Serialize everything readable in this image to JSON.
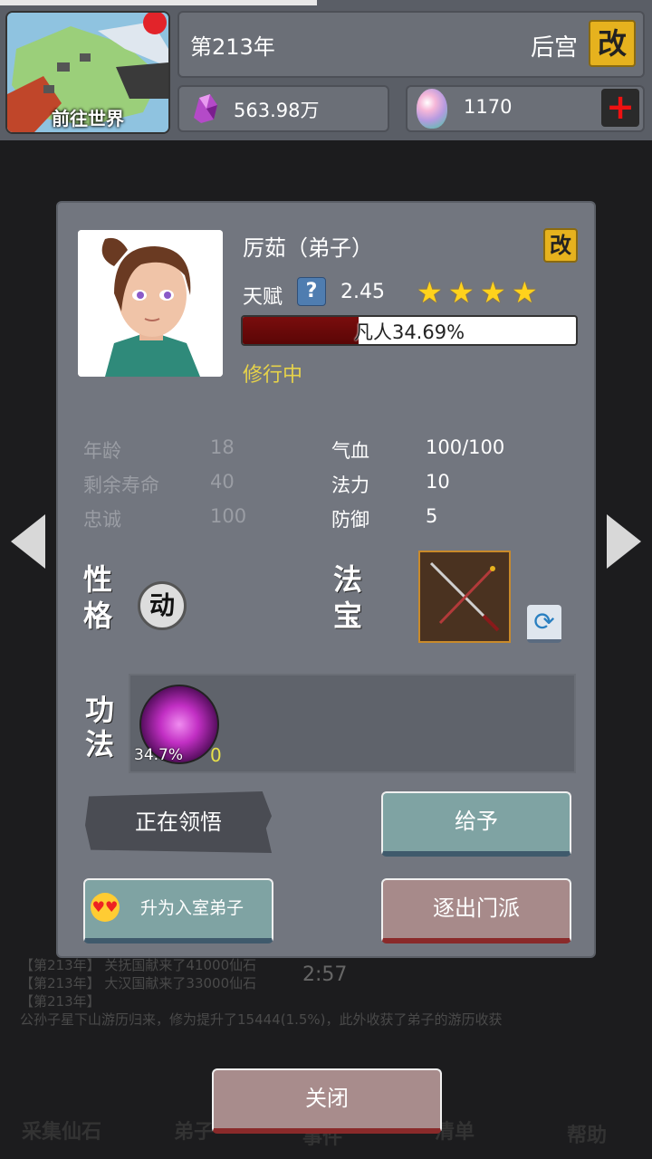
{
  "header": {
    "world_button_label": "前往世界",
    "year": "第213年",
    "harem_label": "后宫",
    "harem_edit": "改",
    "spirit_stones": "563.98万",
    "eggs": "1170",
    "plus_icon": "plus-icon"
  },
  "background": {
    "timer": "2:57",
    "log_lines": [
      "【第213年】 关抚国献来了41000仙石",
      "【第213年】 大汉国献来了33000仙石",
      "【第213年】",
      "公孙子星下山游历归来，修为提升了15444(1.5%)，此外收获了弟子的游历收获"
    ],
    "bottom_nav": [
      "采集仙石",
      "弟子",
      "事件",
      "清单",
      "帮助"
    ]
  },
  "dialog": {
    "name": "厉茹（弟子）",
    "name_edit": "改",
    "talent_label": "天赋",
    "talent_help": "?",
    "talent_value": "2.45",
    "stars": 4,
    "cultivation_text": "凡人34.69%",
    "cultivation_progress": 0.3469,
    "status": "修行中",
    "stats_left": [
      {
        "label": "年龄",
        "value": "18"
      },
      {
        "label": "剩余寿命",
        "value": "40"
      },
      {
        "label": "忠诚",
        "value": "100"
      }
    ],
    "stats_right": [
      {
        "label": "气血",
        "value": "100/100"
      },
      {
        "label": "法力",
        "value": "10"
      },
      {
        "label": "防御",
        "value": "5"
      }
    ],
    "personality_label_1": "性",
    "personality_label_2": "格",
    "personality_value": "动",
    "treasure_label_1": "法",
    "treasure_label_2": "宝",
    "skills_label_1": "功",
    "skills_label_2": "法",
    "skill_progress": "34.7%",
    "skill_count": "0",
    "comprehend_button": "正在领悟",
    "give_button": "给予",
    "promote_button": "升为入室弟子",
    "expel_button": "逐出门派"
  },
  "close_button": "关闭"
}
